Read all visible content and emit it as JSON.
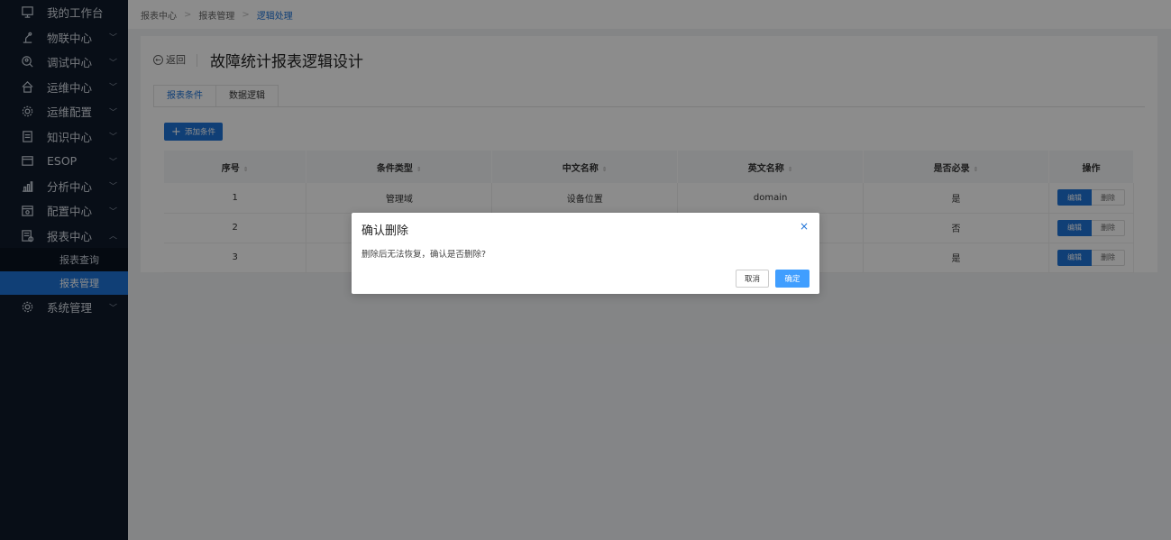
{
  "sidebar": {
    "items": [
      {
        "label": "我的工作台",
        "icon": "monitor-icon",
        "has_children": false
      },
      {
        "label": "物联中心",
        "icon": "robot-arm-icon",
        "has_children": true
      },
      {
        "label": "调试中心",
        "icon": "debug-icon",
        "has_children": true
      },
      {
        "label": "运维中心",
        "icon": "house-icon",
        "has_children": true
      },
      {
        "label": "运维配置",
        "icon": "gear-icon",
        "has_children": true
      },
      {
        "label": "知识中心",
        "icon": "book-icon",
        "has_children": true
      },
      {
        "label": "ESOP",
        "icon": "esop-icon",
        "has_children": true
      },
      {
        "label": "分析中心",
        "icon": "bar-chart-icon",
        "has_children": true
      },
      {
        "label": "配置中心",
        "icon": "settings-panel-icon",
        "has_children": true
      },
      {
        "label": "报表中心",
        "icon": "report-icon",
        "has_children": true,
        "expanded": true
      }
    ],
    "report_sub": [
      {
        "label": "报表查询",
        "active": false
      },
      {
        "label": "报表管理",
        "active": true
      }
    ],
    "system": {
      "label": "系统管理",
      "icon": "gear-icon"
    },
    "chevron_down": "﹀",
    "chevron_up": "︿"
  },
  "breadcrumb": [
    "报表中心",
    "报表管理",
    "逻辑处理"
  ],
  "header": {
    "back_label": "返回",
    "title": "故障统计报表逻辑设计"
  },
  "tabs": [
    {
      "label": "报表条件",
      "active": true
    },
    {
      "label": "数据逻辑",
      "active": false
    }
  ],
  "add_button": "添加条件",
  "table": {
    "columns": [
      "序号",
      "条件类型",
      "中文名称",
      "英文名称",
      "是否必录",
      "操作"
    ],
    "rows": [
      {
        "no": "1",
        "type": "管理域",
        "cn": "设备位置",
        "en": "domain",
        "required": "是"
      },
      {
        "no": "2",
        "type": "",
        "cn": "",
        "en": "",
        "required": "否"
      },
      {
        "no": "3",
        "type": "",
        "cn": "",
        "en": "",
        "required": "是"
      }
    ],
    "edit_label": "编辑",
    "delete_label": "删除"
  },
  "modal": {
    "title": "确认删除",
    "message": "删除后无法恢复，确认是否删除?",
    "cancel": "取消",
    "confirm": "确定",
    "close": "×"
  }
}
